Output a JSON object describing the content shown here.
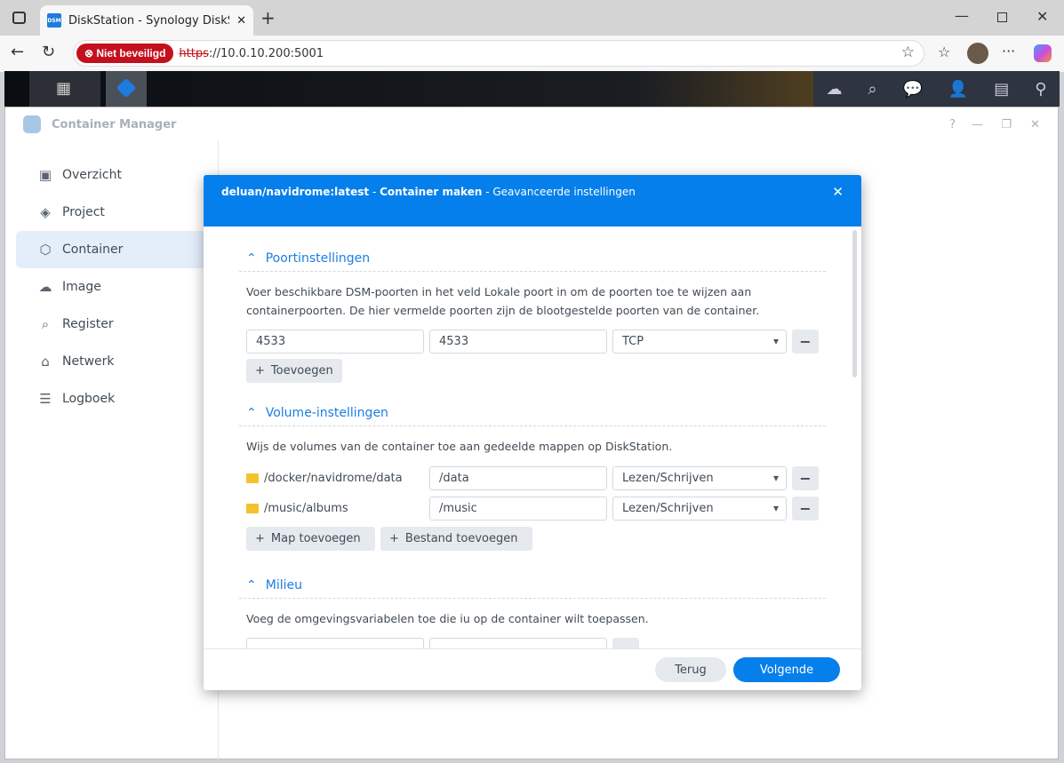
{
  "browser": {
    "tab_title": "DiskStation - Synology DiskStation",
    "security_badge": "Niet beveiligd",
    "url_scheme": "https",
    "url_rest": "://10.0.10.200:5001"
  },
  "app": {
    "title": "Container Manager"
  },
  "sidebar": {
    "items": [
      {
        "label": "Overzicht",
        "icon": "dashboard-icon"
      },
      {
        "label": "Project",
        "icon": "layers-icon"
      },
      {
        "label": "Container",
        "icon": "cube-icon",
        "active": true
      },
      {
        "label": "Image",
        "icon": "cloud-icon"
      },
      {
        "label": "Register",
        "icon": "registry-search-icon"
      },
      {
        "label": "Netwerk",
        "icon": "network-icon"
      },
      {
        "label": "Logboek",
        "icon": "list-icon"
      }
    ]
  },
  "dialog": {
    "title_image": "deluan/navidrome:latest",
    "title_sep1": " - ",
    "title_action": "Container maken",
    "title_sep2": " - ",
    "title_step": "Geavanceerde instellingen",
    "ports": {
      "heading": "Poortinstellingen",
      "description": "Voer beschikbare DSM-poorten in het veld Lokale poort in om de poorten toe te wijzen aan containerpoorten. De hier vermelde poorten zijn de blootgestelde poorten van de container.",
      "rows": [
        {
          "local": "4533",
          "container": "4533",
          "protocol": "TCP"
        }
      ],
      "add_label": "Toevoegen"
    },
    "volumes": {
      "heading": "Volume-instellingen",
      "description": "Wijs de volumes van de container toe aan gedeelde mappen op DiskStation.",
      "rows": [
        {
          "folder": "/docker/navidrome/data",
          "mount": "/data",
          "mode": "Lezen/Schrijven"
        },
        {
          "folder": "/music/albums",
          "mount": "/music",
          "mode": "Lezen/Schrijven"
        }
      ],
      "add_folder_label": "Map toevoegen",
      "add_file_label": "Bestand toevoegen"
    },
    "env": {
      "heading": "Milieu",
      "description": "Voeg de omgevingsvariabelen toe die iu op de container wilt toepassen."
    },
    "back_label": "Terug",
    "next_label": "Volgende"
  },
  "colors": {
    "accent": "#057feb",
    "danger": "#c4101d"
  }
}
